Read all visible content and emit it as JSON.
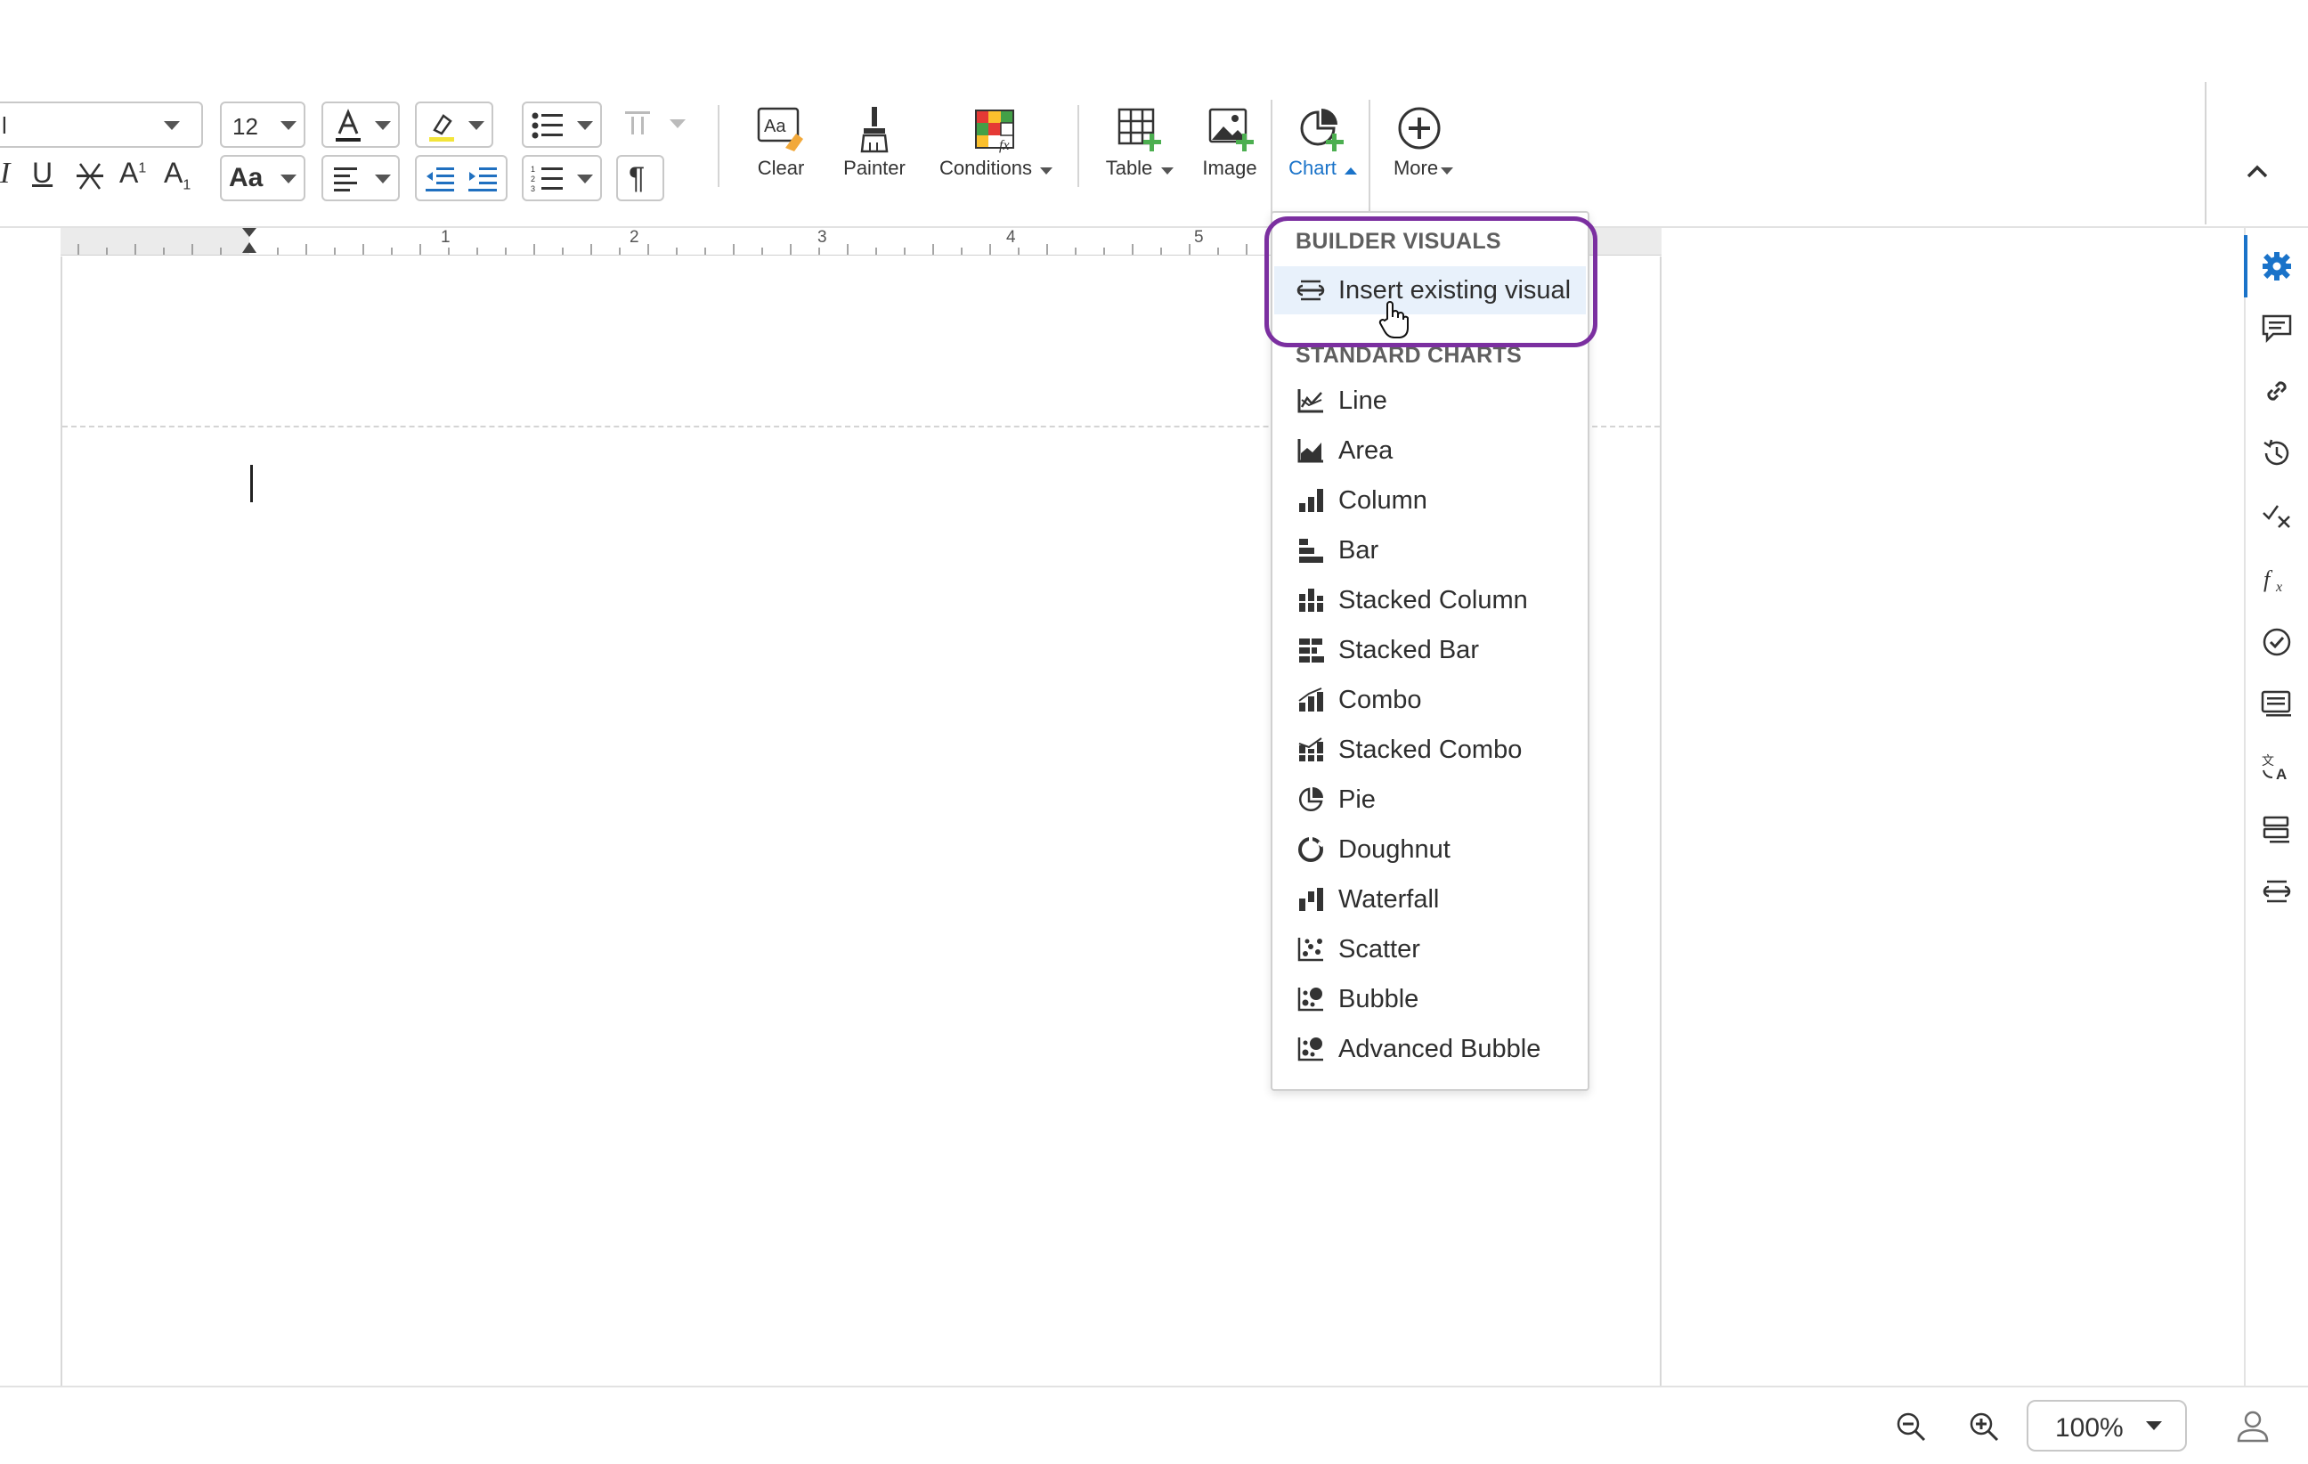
{
  "toolbar": {
    "font_name_value": "l",
    "font_size_value": "12",
    "case_button_label": "Aa",
    "buttons": {
      "clear": "Clear",
      "painter": "Painter",
      "conditions": "Conditions",
      "table": "Table",
      "image": "Image",
      "chart": "Chart",
      "more": "More"
    },
    "active_button": "chart"
  },
  "ruler": {
    "marks": [
      "1",
      "2",
      "3",
      "4",
      "5"
    ]
  },
  "chart_menu": {
    "builder_heading": "BUILDER VISUALS",
    "builder_item": {
      "label": "Insert existing visual",
      "icon": "visual-link-icon"
    },
    "standard_heading": "STANDARD CHARTS",
    "items": [
      {
        "label": "Line",
        "icon": "line-chart-icon"
      },
      {
        "label": "Area",
        "icon": "area-chart-icon"
      },
      {
        "label": "Column",
        "icon": "column-chart-icon"
      },
      {
        "label": "Bar",
        "icon": "bar-chart-icon"
      },
      {
        "label": "Stacked Column",
        "icon": "stacked-column-chart-icon"
      },
      {
        "label": "Stacked Bar",
        "icon": "stacked-bar-chart-icon"
      },
      {
        "label": "Combo",
        "icon": "combo-chart-icon"
      },
      {
        "label": "Stacked Combo",
        "icon": "stacked-combo-chart-icon"
      },
      {
        "label": "Pie",
        "icon": "pie-chart-icon"
      },
      {
        "label": "Doughnut",
        "icon": "doughnut-chart-icon"
      },
      {
        "label": "Waterfall",
        "icon": "waterfall-chart-icon"
      },
      {
        "label": "Scatter",
        "icon": "scatter-chart-icon"
      },
      {
        "label": "Bubble",
        "icon": "bubble-chart-icon"
      },
      {
        "label": "Advanced Bubble",
        "icon": "advanced-bubble-chart-icon"
      }
    ]
  },
  "sidebar": {
    "icons": [
      "gear-icon",
      "comment-icon",
      "link-icon",
      "history-icon",
      "check-x-icon",
      "function-icon",
      "check-circle-icon",
      "list-icon",
      "translate-icon",
      "rows-icon",
      "visual-link-icon"
    ]
  },
  "status": {
    "zoom": "100%"
  },
  "colors": {
    "accent": "#1a73c9",
    "highlight_ring": "#7b2fa0",
    "selected_item_bg": "#e8f1fb"
  }
}
